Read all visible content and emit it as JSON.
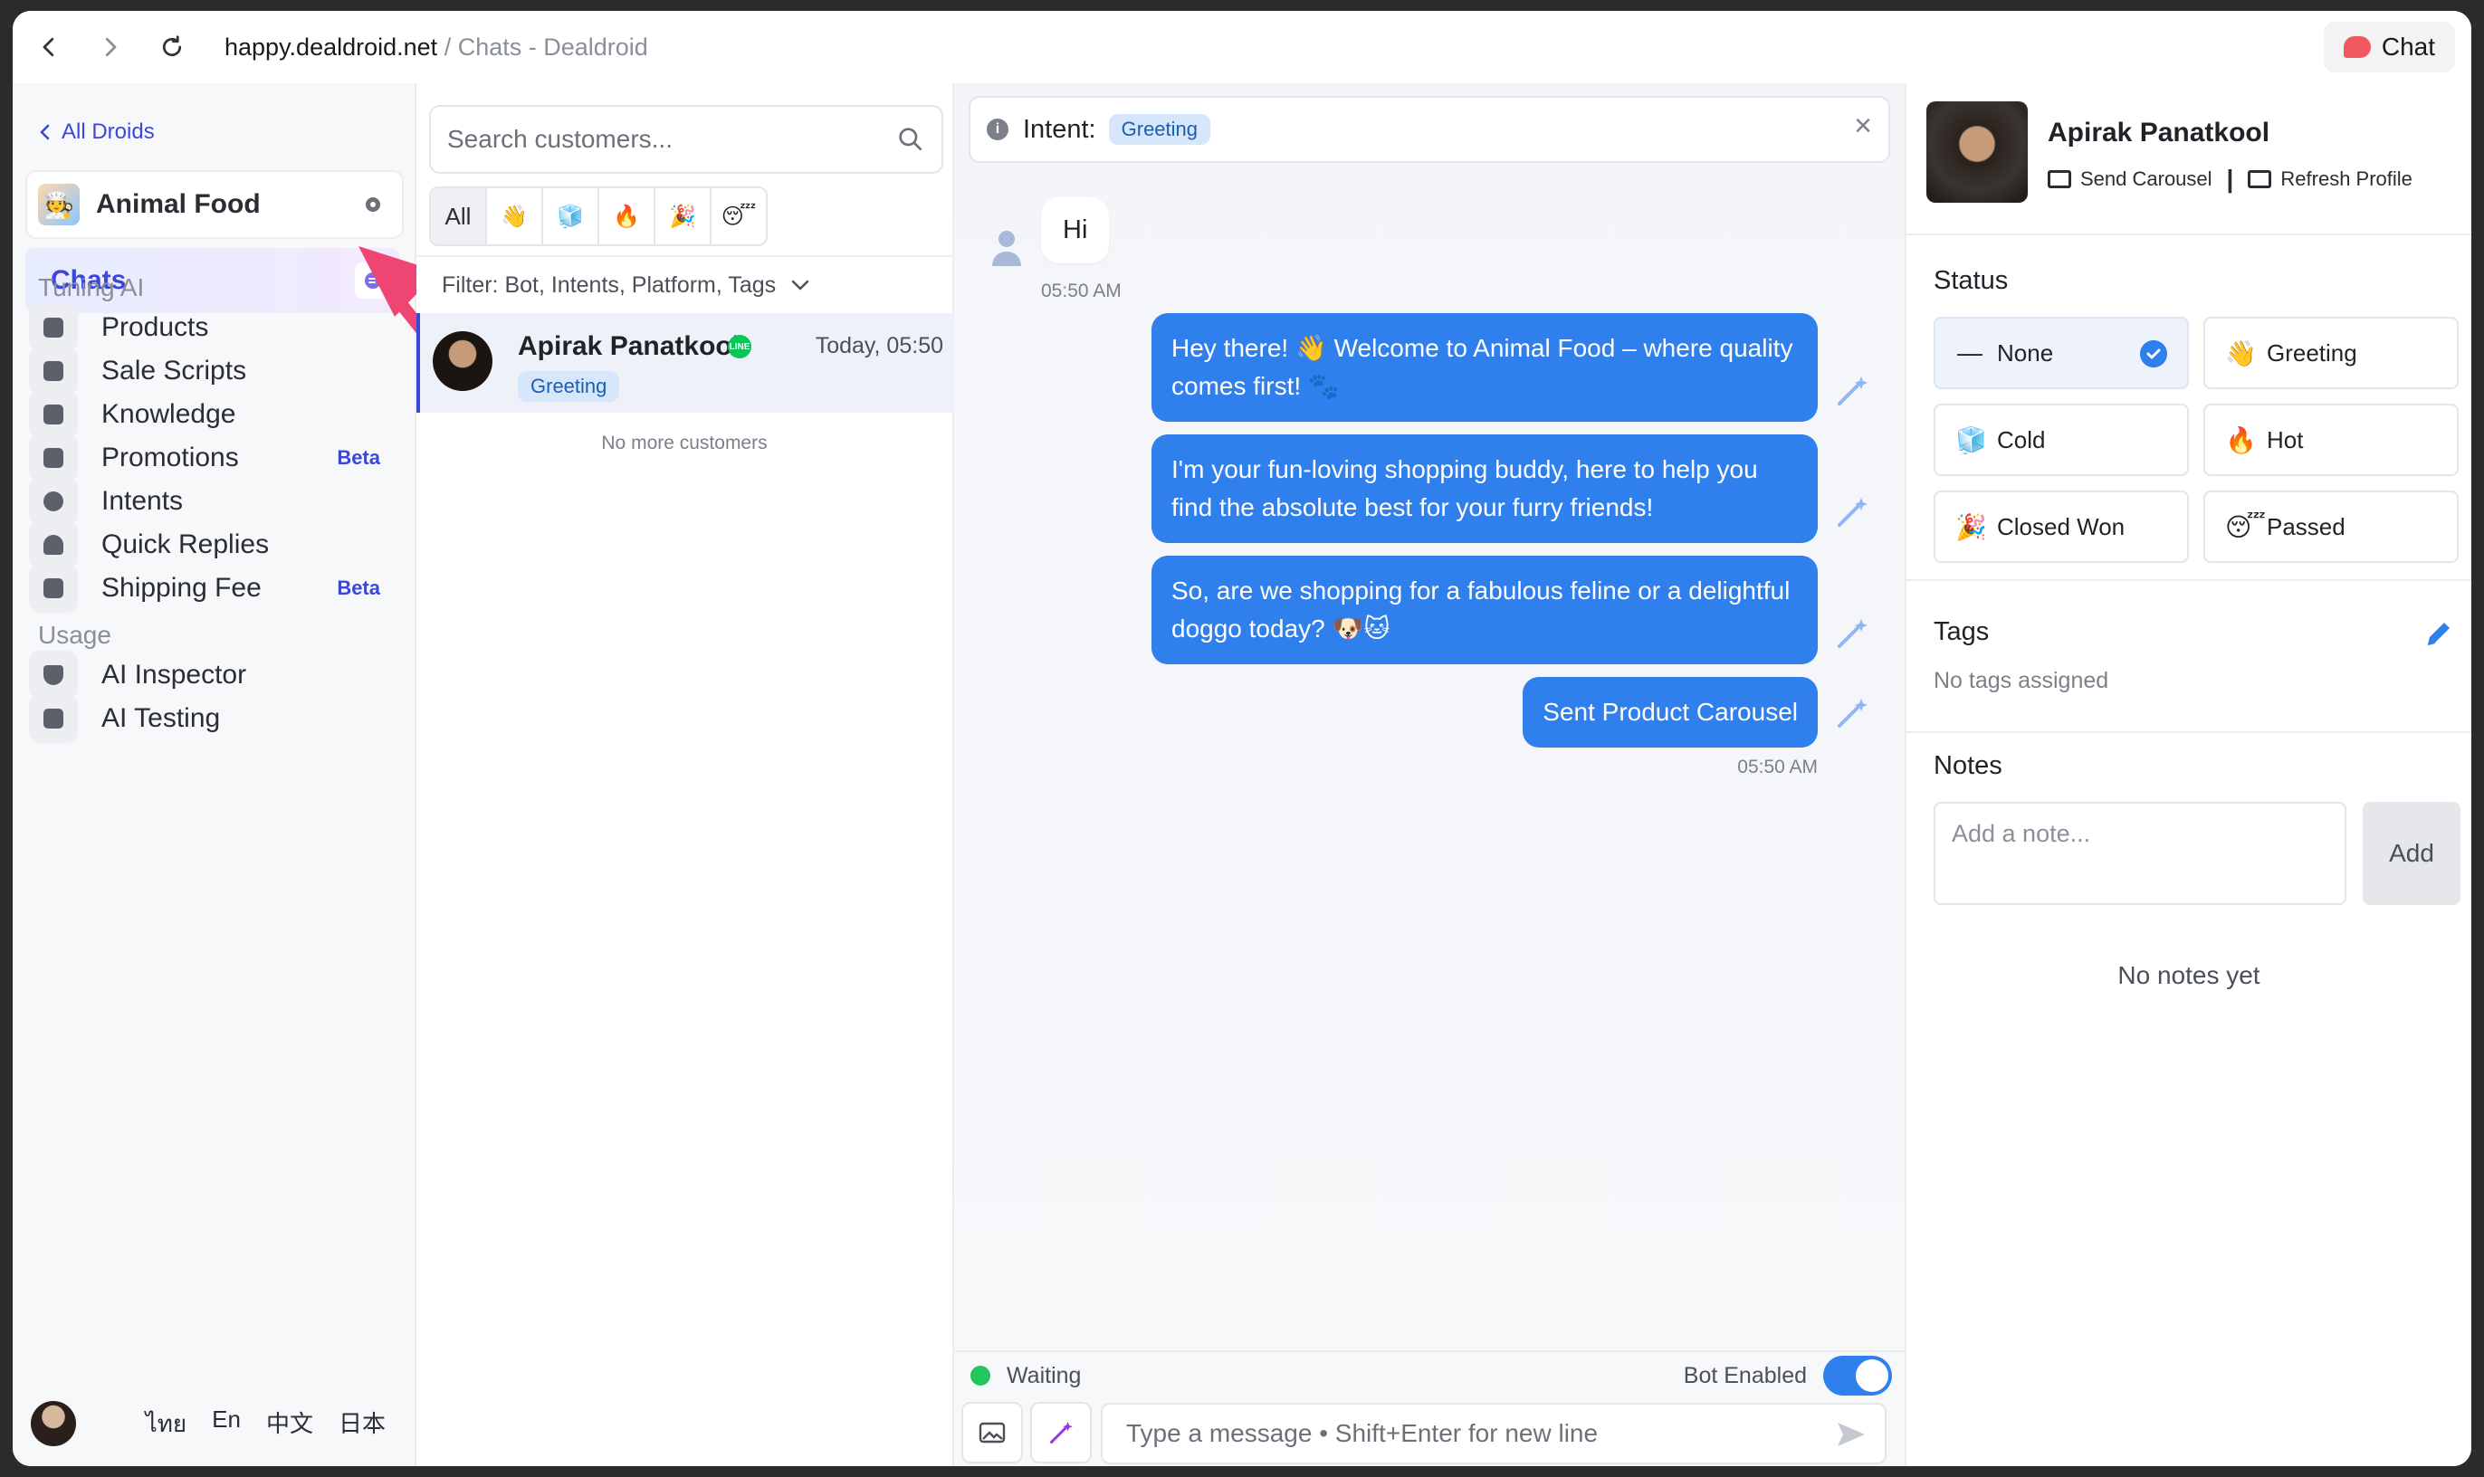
{
  "browser": {
    "domain": "happy.dealdroid.net",
    "path": " / Chats - Dealdroid",
    "chat_button_label": "Chat"
  },
  "sidebar": {
    "back_link": "All Droids",
    "droid_name": "Animal Food",
    "droid_avatar_emoji": "🧑‍🍳",
    "active_item": "Chats",
    "sections": [
      {
        "title": "Tuning AI"
      },
      {
        "title": "Usage"
      }
    ],
    "items": [
      {
        "label": "Products",
        "badge": ""
      },
      {
        "label": "Sale Scripts",
        "badge": ""
      },
      {
        "label": "Knowledge",
        "badge": ""
      },
      {
        "label": "Promotions",
        "badge": "Beta"
      },
      {
        "label": "Intents",
        "badge": ""
      },
      {
        "label": "Quick Replies",
        "badge": ""
      },
      {
        "label": "Shipping Fee",
        "badge": "Beta"
      },
      {
        "label": "AI Inspector",
        "badge": ""
      },
      {
        "label": "AI Testing",
        "badge": ""
      }
    ],
    "languages": [
      "ไทย",
      "En",
      "中文",
      "日本"
    ]
  },
  "customers": {
    "search_placeholder": "Search customers...",
    "filter_tabs": [
      "All",
      "👋",
      "🧊",
      "🔥",
      "🎉",
      "😴"
    ],
    "filter_label": "Filter: Bot, Intents, Platform, Tags",
    "list": [
      {
        "name": "Apirak Panatkool",
        "platform": "LINE",
        "time": "Today, 05:50",
        "tag": "Greeting"
      }
    ],
    "footer": "No more customers"
  },
  "chat": {
    "intent_label": "Intent:",
    "intent_value": "Greeting",
    "messages": [
      {
        "from": "customer",
        "text": "Hi",
        "time": "05:50 AM"
      },
      {
        "from": "bot",
        "text": "Hey there! 👋 Welcome to Animal Food – where quality comes first! 🐾"
      },
      {
        "from": "bot",
        "text": "I'm your fun-loving shopping buddy, here to help you find the absolute best for your furry friends!"
      },
      {
        "from": "bot",
        "text": "So, are we shopping for a fabulous feline or a delightful doggo today? 🐶🐱"
      },
      {
        "from": "bot",
        "text": "Sent Product Carousel",
        "time": "05:50 AM"
      }
    ],
    "status": "Waiting",
    "bot_toggle_label": "Bot Enabled",
    "bot_enabled": true,
    "input_placeholder": "Type a message • Shift+Enter for new line"
  },
  "profile": {
    "name": "Apirak Panatkool",
    "send_carousel": "Send Carousel",
    "refresh_profile": "Refresh Profile",
    "status_title": "Status",
    "statuses": [
      {
        "emoji": "—",
        "label": "None",
        "selected": true
      },
      {
        "emoji": "👋",
        "label": "Greeting",
        "selected": false
      },
      {
        "emoji": "🧊",
        "label": "Cold",
        "selected": false
      },
      {
        "emoji": "🔥",
        "label": "Hot",
        "selected": false
      },
      {
        "emoji": "🎉",
        "label": "Closed Won",
        "selected": false
      },
      {
        "emoji": "😴",
        "label": "Passed",
        "selected": false
      }
    ],
    "tags_title": "Tags",
    "tags_empty": "No tags assigned",
    "notes_title": "Notes",
    "note_placeholder": "Add a note...",
    "add_button": "Add",
    "notes_empty": "No notes yet"
  },
  "colors": {
    "accent": "#2f80ed",
    "brand_link": "#3b47d9",
    "annotation_arrow": "#ef4573"
  }
}
